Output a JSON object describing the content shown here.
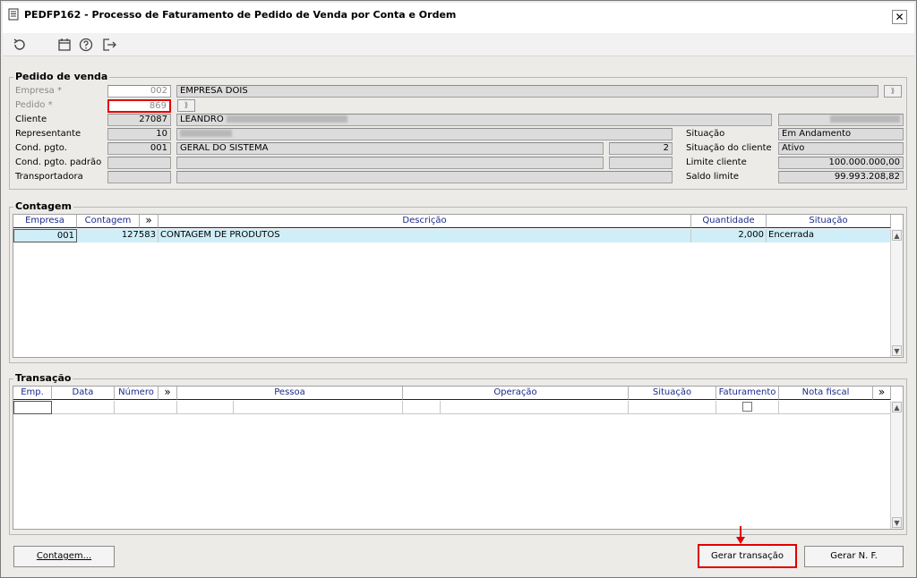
{
  "window": {
    "title": "PEDFP162 - Processo de Faturamento de Pedido de Venda por Conta e Ordem",
    "close_glyph": "✕"
  },
  "toolbar": {
    "icons": [
      "refresh-icon",
      "calendar-icon",
      "help-icon",
      "exit-icon"
    ]
  },
  "pedido": {
    "section_title": "Pedido de venda",
    "empresa_label": "Empresa *",
    "empresa_code": "002",
    "empresa_name": "EMPRESA DOIS",
    "pedido_label": "Pedido *",
    "pedido_value": "869",
    "cliente_label": "Cliente",
    "cliente_code": "27087",
    "cliente_name": "LEANDRO",
    "representante_label": "Representante",
    "representante_code": "10",
    "condpgto_label": "Cond. pgto.",
    "condpgto_code": "001",
    "condpgto_name": "GERAL DO SISTEMA",
    "condpgto_num": "2",
    "condpgto_padrao_label": "Cond. pgto. padrão",
    "transportadora_label": "Transportadora",
    "situacao_label": "Situação",
    "situacao_value": "Em Andamento",
    "situacao_cliente_label": "Situação do cliente",
    "situacao_cliente_value": "Ativo",
    "limite_label": "Limite cliente",
    "limite_value": "100.000.000,00",
    "saldo_label": "Saldo limite",
    "saldo_value": "99.993.208,82"
  },
  "contagem": {
    "section_title": "Contagem",
    "headers": {
      "empresa": "Empresa",
      "contagem": "Contagem",
      "more": "»",
      "descricao": "Descrição",
      "quantidade": "Quantidade",
      "situacao": "Situação"
    },
    "rows": [
      {
        "empresa": "001",
        "contagem": "127583",
        "descricao": "CONTAGEM DE PRODUTOS",
        "quantidade": "2,000",
        "situacao": "Encerrada"
      }
    ]
  },
  "transacao": {
    "section_title": "Transação",
    "headers": {
      "emp": "Emp.",
      "data": "Data",
      "numero": "Número",
      "more1": "»",
      "pessoa": "Pessoa",
      "operacao": "Operação",
      "situacao": "Situação",
      "faturamento": "Faturamento",
      "nota_fiscal": "Nota fiscal",
      "more2": "»"
    }
  },
  "footer": {
    "contagem_button": "Contagem...",
    "gerar_transacao_button": "Gerar transação",
    "gerar_nf_button": "Gerar N. F."
  },
  "colors": {
    "highlight_red": "#e00000",
    "row_selected": "#cfeef8",
    "header_text": "#1a2a8c"
  }
}
